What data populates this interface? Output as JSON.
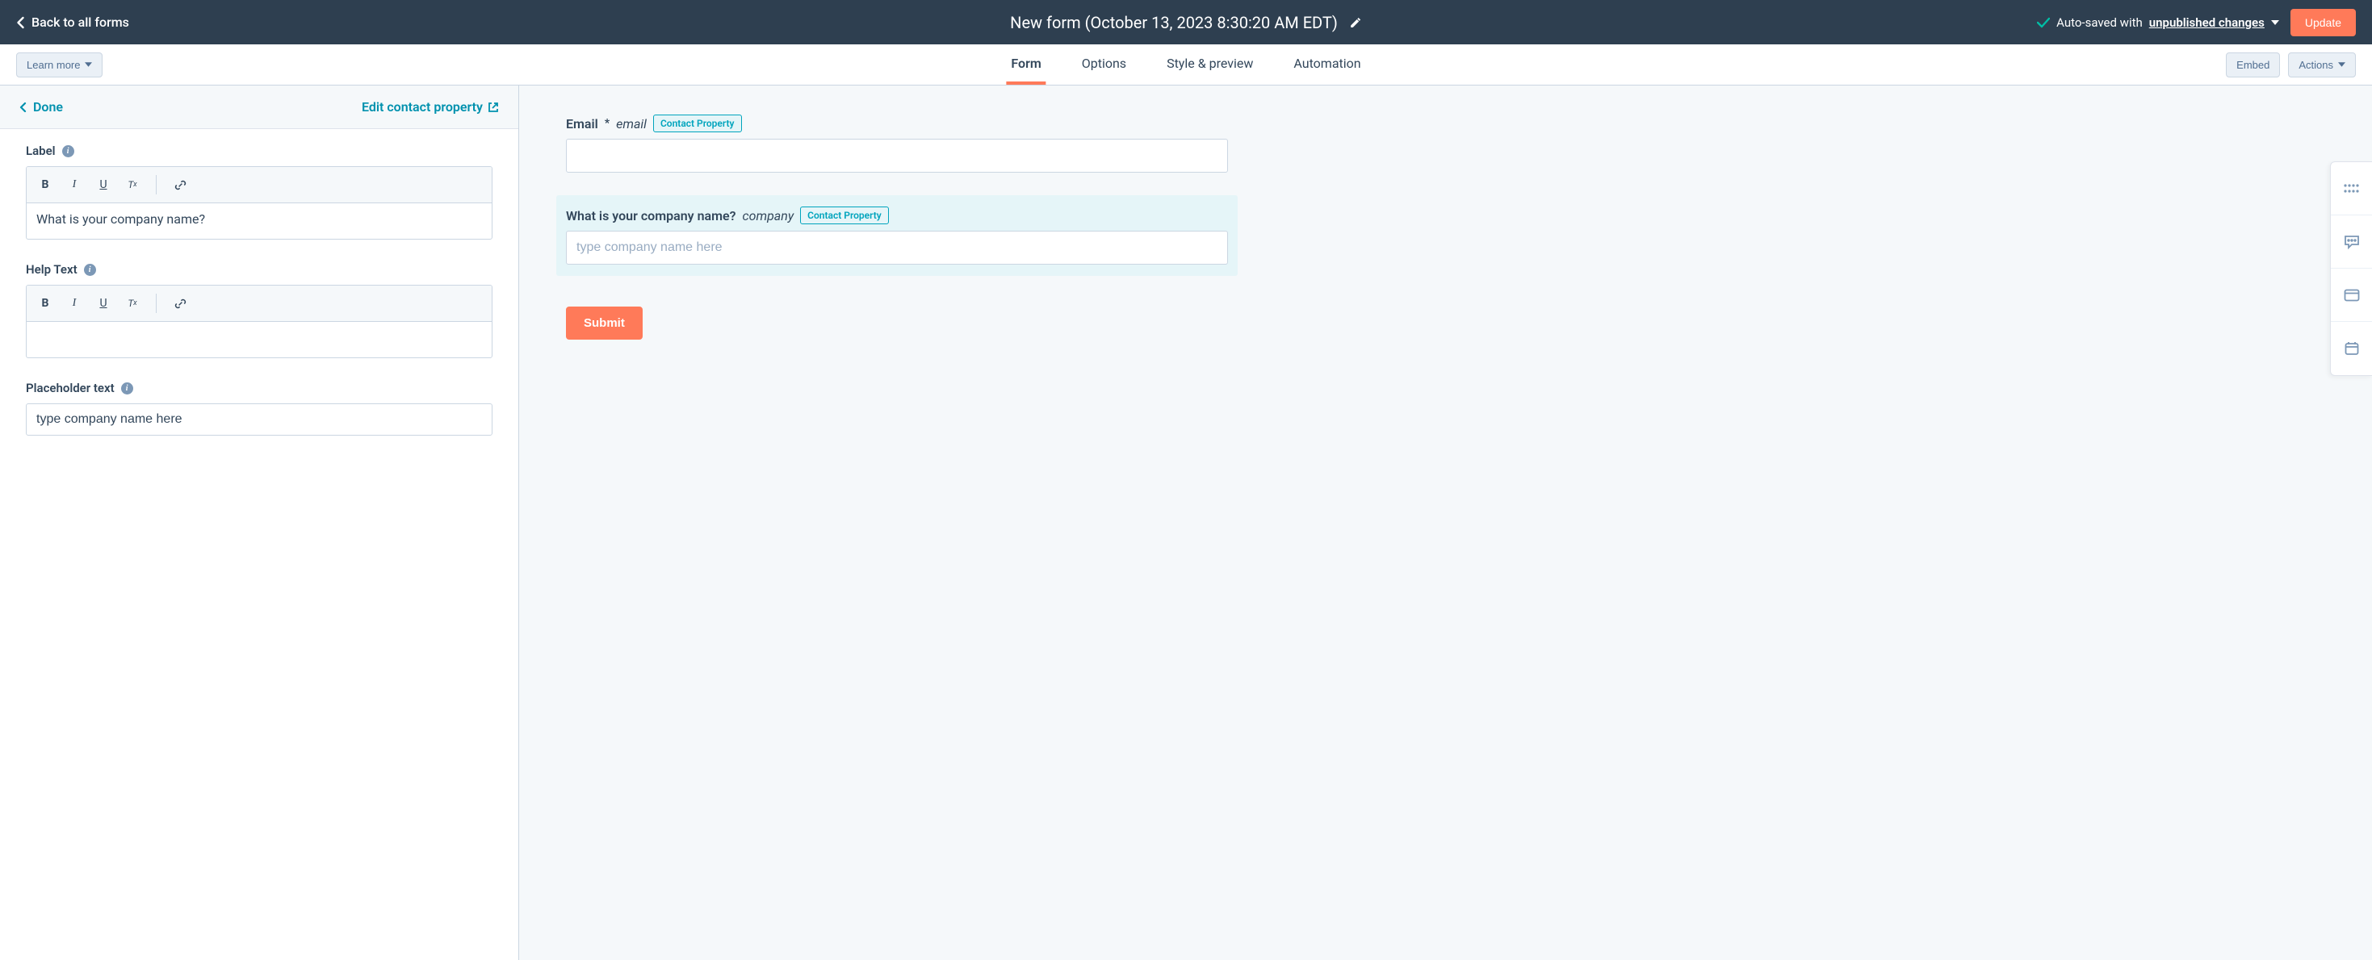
{
  "header": {
    "back_label": "Back to all forms",
    "form_title": "New form (October 13, 2023 8:30:20 AM EDT)",
    "autosave_prefix": "Auto-saved with ",
    "autosave_unpublished": "unpublished changes",
    "update_btn": "Update"
  },
  "secbar": {
    "learn_more": "Learn more",
    "embed": "Embed",
    "actions": "Actions",
    "tabs": [
      "Form",
      "Options",
      "Style & preview",
      "Automation"
    ],
    "active_tab": 0
  },
  "left": {
    "done": "Done",
    "edit_prop": "Edit contact property",
    "label_heading": "Label",
    "label_value": "What is your company name?",
    "help_heading": "Help Text",
    "help_value": "",
    "placeholder_heading": "Placeholder text",
    "placeholder_value": "type company name here"
  },
  "rte_icons": {
    "bold": "B",
    "italic": "I",
    "underline": "U",
    "clear": "Tx"
  },
  "preview": {
    "fields": [
      {
        "label": "Email",
        "required_mark": "*",
        "slug": "email",
        "badge": "Contact Property",
        "placeholder": "",
        "selected": false
      },
      {
        "label": "What is your company name?",
        "required_mark": "",
        "slug": "company",
        "badge": "Contact Property",
        "placeholder": "type company name here",
        "selected": true
      }
    ],
    "submit": "Submit"
  },
  "colors": {
    "accent": "#ff7a59",
    "teal": "#00a4bd",
    "dark": "#2e3f50"
  }
}
